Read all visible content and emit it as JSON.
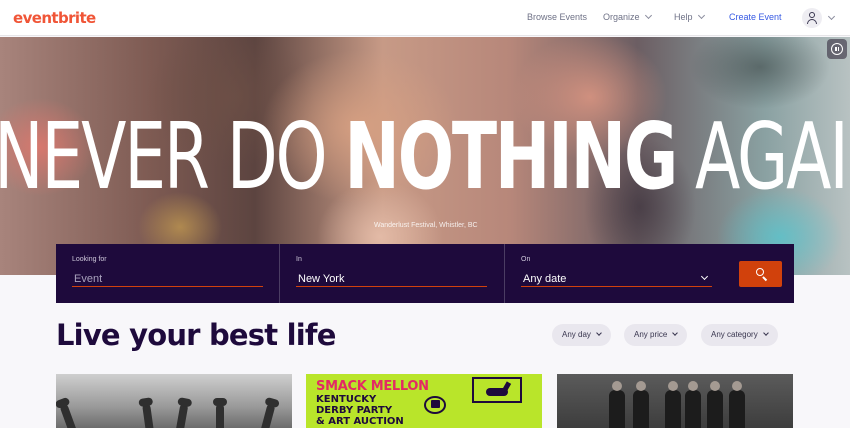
{
  "nav": {
    "logo": "eventbrite",
    "links": [
      {
        "label": "Browse Events"
      },
      {
        "label": "Organize"
      },
      {
        "label": "Help"
      }
    ],
    "create_label": "Create Event"
  },
  "hero": {
    "headline_1": "NEVER DO ",
    "headline_2": "NOTHING",
    "headline_3": " AGAIN",
    "credit": "Wanderlust Festival, Whistler, BC"
  },
  "search": {
    "fields": [
      {
        "label": "Looking for",
        "placeholder": "Event"
      },
      {
        "label": "In",
        "value": "New York"
      },
      {
        "label": "On",
        "value": "Any date"
      }
    ]
  },
  "section": {
    "title": "Live your best life",
    "filters": [
      "Any day",
      "Any price",
      "Any category"
    ]
  },
  "cards": {
    "card2_title": "SMACK MELLON",
    "card2_line1": "KENTUCKY",
    "card2_line2": "DERBY PARTY",
    "card2_line3": "& ART AUCTION"
  },
  "colors": {
    "brand": "#f05537",
    "accent_blue": "#3659e3",
    "search_bg": "#1e0a3c",
    "search_button": "#d1410c",
    "card_lime": "#b9e52a"
  },
  "icons": {
    "search_button": "search-icon",
    "pause": "pause-icon",
    "avatar": "user-icon"
  }
}
